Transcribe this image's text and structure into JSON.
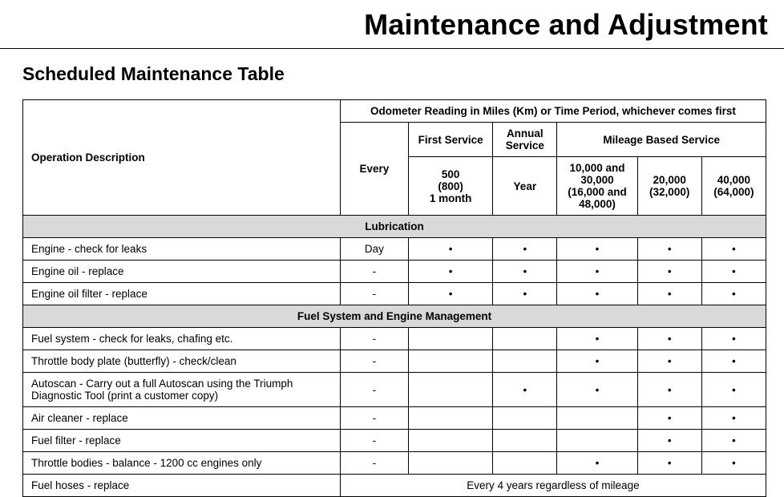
{
  "pageTitle": "Maintenance and Adjustment",
  "sectionTitle": "Scheduled Maintenance Table",
  "headers": {
    "opDesc": "Operation Description",
    "odometer": "Odometer Reading in Miles (Km) or Time Period, whichever comes first",
    "first": "First Service",
    "annual": "Annual Service",
    "mileage": "Mileage Based Service",
    "every": "Every",
    "first_detail": "500\n(800)\n1 month",
    "annual_detail": "Year",
    "m1": "10,000 and 30,000 (16,000 and 48,000)",
    "m2": "20,000 (32,000)",
    "m3": "40,000 (64,000)"
  },
  "dot": "•",
  "dash": "-",
  "sections": {
    "lubrication": "Lubrication",
    "fuel": "Fuel System and Engine Management"
  },
  "rows": {
    "r1": {
      "desc": "Engine - check for leaks",
      "c1": "Day",
      "c2": "•",
      "c3": "•",
      "c4": "•",
      "c5": "•",
      "c6": "•"
    },
    "r2": {
      "desc": "Engine oil - replace",
      "c1": "-",
      "c2": "•",
      "c3": "•",
      "c4": "•",
      "c5": "•",
      "c6": "•"
    },
    "r3": {
      "desc": "Engine oil filter - replace",
      "c1": "-",
      "c2": "•",
      "c3": "•",
      "c4": "•",
      "c5": "•",
      "c6": "•"
    },
    "r4": {
      "desc": "Fuel system - check for leaks, chafing etc.",
      "c1": "-",
      "c2": "",
      "c3": "",
      "c4": "•",
      "c5": "•",
      "c6": "•"
    },
    "r5": {
      "desc": "Throttle body plate (butterfly) - check/clean",
      "c1": "-",
      "c2": "",
      "c3": "",
      "c4": "•",
      "c5": "•",
      "c6": "•"
    },
    "r6": {
      "desc": "Autoscan - Carry out a full Autoscan using the Triumph Diagnostic Tool (print a customer copy)",
      "c1": "-",
      "c2": "",
      "c3": "•",
      "c4": "•",
      "c5": "•",
      "c6": "•"
    },
    "r7": {
      "desc": "Air cleaner - replace",
      "c1": "-",
      "c2": "",
      "c3": "",
      "c4": "",
      "c5": "•",
      "c6": "•"
    },
    "r8": {
      "desc": "Fuel filter - replace",
      "c1": "-",
      "c2": "",
      "c3": "",
      "c4": "",
      "c5": "•",
      "c6": "•"
    },
    "r9": {
      "desc": "Throttle bodies - balance - 1200 cc engines only",
      "c1": "-",
      "c2": "",
      "c3": "",
      "c4": "•",
      "c5": "•",
      "c6": "•"
    },
    "r10": {
      "desc": "Fuel hoses - replace",
      "span": "Every 4 years regardless of mileage"
    }
  }
}
